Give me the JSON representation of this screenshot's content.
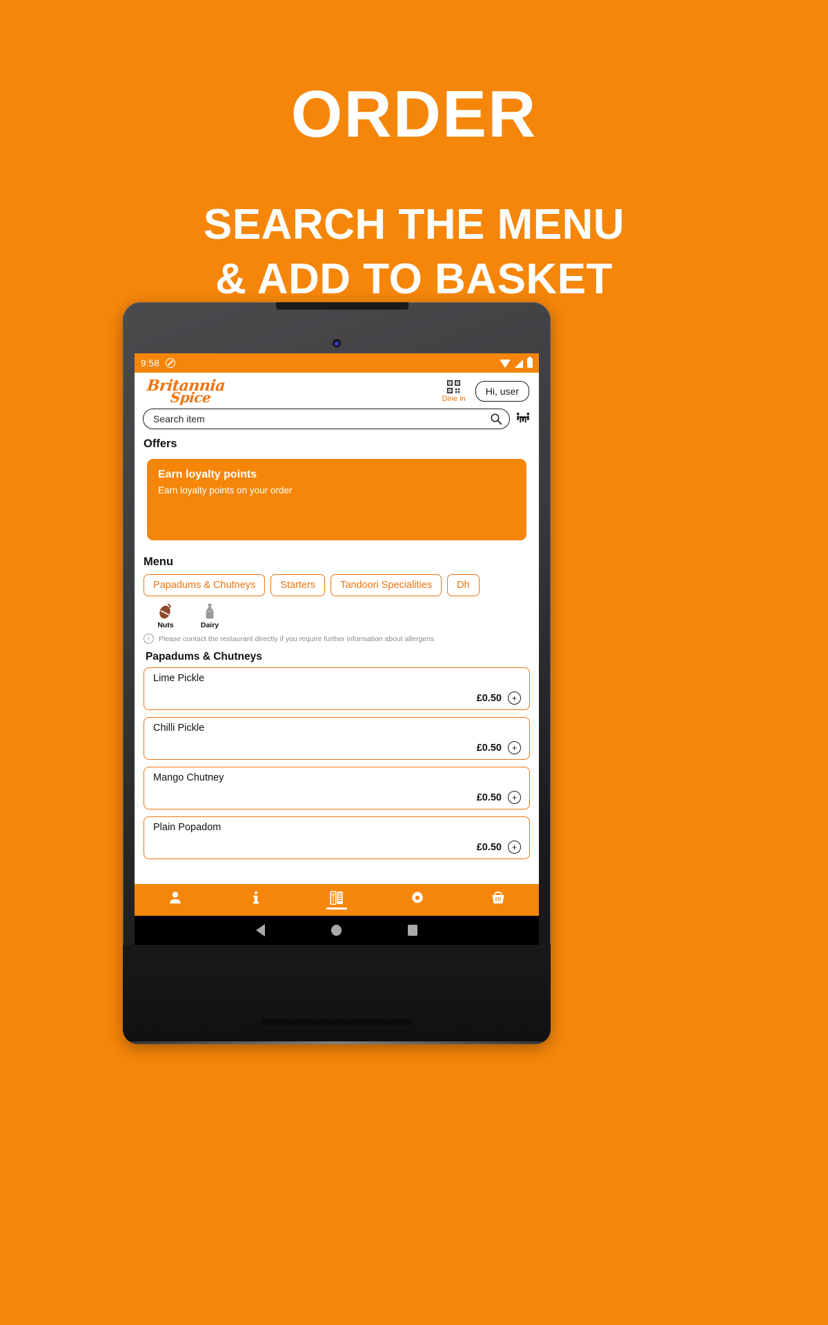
{
  "promo": {
    "headline": "ORDER",
    "subheadline_lines": [
      "SEARCH THE MENU",
      "& ADD TO BASKET"
    ],
    "background_color": "#F5860A",
    "text_color": "#FFFFFF"
  },
  "device": {
    "type": "android-tablet",
    "bezel_color": "#2C2C2E"
  },
  "statusbar": {
    "time": "9:58",
    "icons": [
      "do-not-disturb-icon",
      "wifi-icon",
      "signal-icon",
      "battery-icon"
    ]
  },
  "header": {
    "brand_line1": "Britannia",
    "brand_line2": "Spice",
    "brand_color": "#EE7410",
    "qr_icon": "qr-code-icon",
    "dine_in_label": "Dine in",
    "account_button": "Hi, user"
  },
  "search": {
    "placeholder": "Search item",
    "value": "",
    "search_icon": "search-icon",
    "table_icon": "table-booking-icon"
  },
  "offers": {
    "title": "Offers",
    "cards": [
      {
        "title": "Earn loyalty points",
        "subtitle": "Earn loyalty points on your order"
      }
    ]
  },
  "menu": {
    "title": "Menu",
    "categories": [
      {
        "label": "Papadums & Chutneys",
        "active": true
      },
      {
        "label": "Starters",
        "active": false
      },
      {
        "label": "Tandoori Specialities",
        "active": false
      },
      {
        "label": "Dh",
        "active": false
      }
    ],
    "allergens": [
      {
        "label": "Nuts",
        "icon": "nut-icon",
        "color": "#8C4A2A"
      },
      {
        "label": "Dairy",
        "icon": "milk-bottle-icon",
        "color": "#8F8F8F"
      }
    ],
    "allergen_note": "Please contact the restaurant directly if you require further information about allergens",
    "current_category": "Papadums & Chutneys",
    "items": [
      {
        "name": "Lime Pickle",
        "price": "£0.50",
        "add_label": "+"
      },
      {
        "name": "Chilli Pickle",
        "price": "£0.50",
        "add_label": "+"
      },
      {
        "name": "Mango Chutney",
        "price": "£0.50",
        "add_label": "+"
      },
      {
        "name": "Plain Popadom",
        "price": "£0.50",
        "add_label": "+"
      }
    ]
  },
  "bottom_nav": {
    "items": [
      {
        "name": "account",
        "icon": "person-icon",
        "active": false
      },
      {
        "name": "info",
        "icon": "info-icon",
        "active": false
      },
      {
        "name": "menu",
        "icon": "menu-book-icon",
        "active": true
      },
      {
        "name": "settings",
        "icon": "gear-icon",
        "active": false
      },
      {
        "name": "basket",
        "icon": "basket-icon",
        "active": false
      }
    ],
    "background_color": "#F5860A"
  },
  "system_nav": {
    "items": [
      {
        "name": "back",
        "icon": "triangle-back-icon"
      },
      {
        "name": "home",
        "icon": "circle-home-icon"
      },
      {
        "name": "recents",
        "icon": "square-recents-icon"
      }
    ]
  }
}
